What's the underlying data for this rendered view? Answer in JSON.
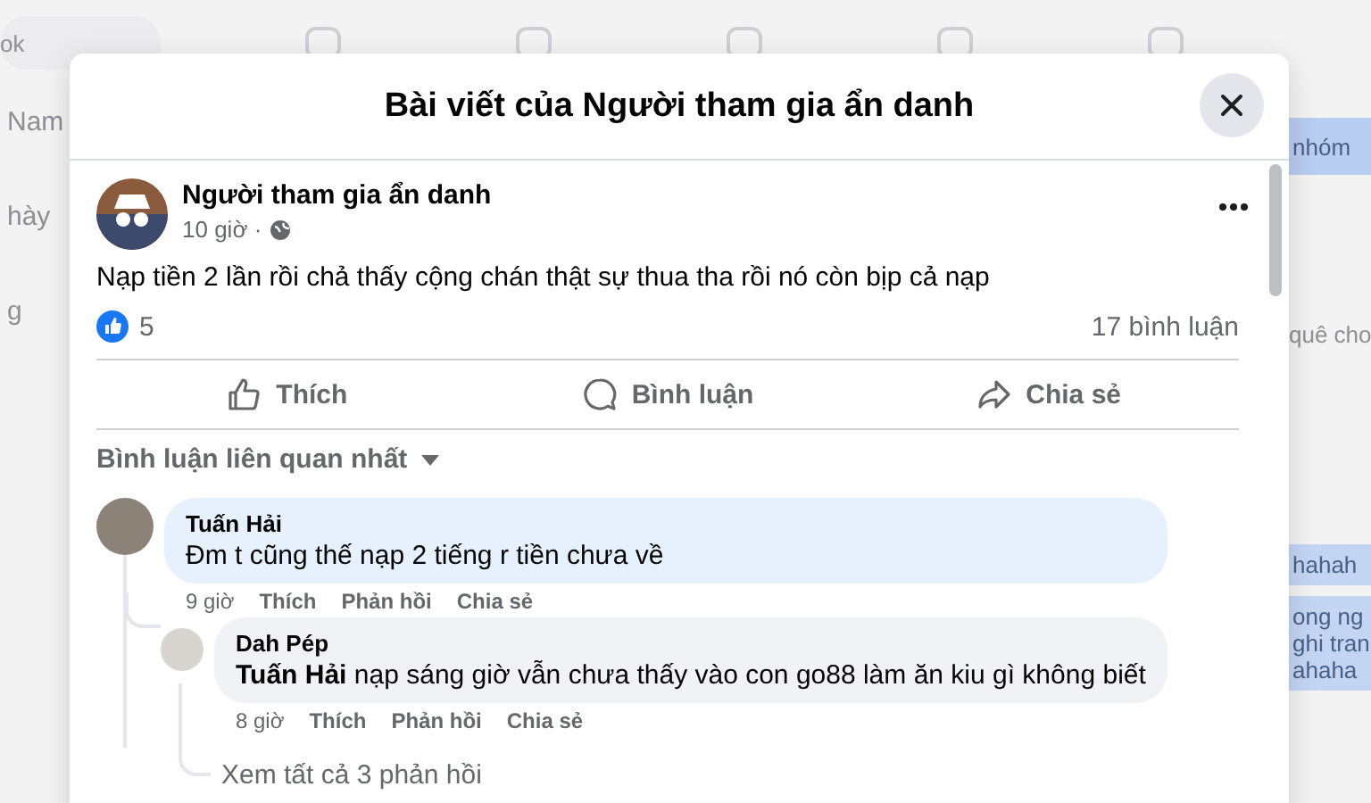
{
  "background": {
    "search_placeholder": "ok",
    "left_items": [
      "Nam",
      "hày",
      "g"
    ],
    "right_items": [
      {
        "kind": "button",
        "lines": [
          "nhóm"
        ]
      },
      {
        "kind": "text",
        "lines": [
          "quê cho"
        ]
      },
      {
        "kind": "bubble",
        "lines": [
          "hahah"
        ]
      },
      {
        "kind": "bubble",
        "lines": [
          "ong ng",
          "ghi tran",
          "ahaha"
        ]
      }
    ]
  },
  "dialog": {
    "title": "Bài viết của Người tham gia ẩn danh"
  },
  "post": {
    "author": "Người tham gia ẩn danh",
    "time": "10 giờ ·",
    "text": "Nạp tiền 2 lần rồi chả thấy cộng chán thật sự thua tha rồi nó còn bịp cả nạp",
    "reaction_count": "5",
    "comment_count": "17 bình luận",
    "actions": [
      {
        "kind": "like",
        "label": "Thích"
      },
      {
        "kind": "comment",
        "label": "Bình luận"
      },
      {
        "kind": "share",
        "label": "Chia sẻ"
      }
    ]
  },
  "sort": {
    "label": "Bình luận liên quan nhất"
  },
  "comments": [
    {
      "author": "Tuấn Hải",
      "text": "Đm t cũng thế nạp 2 tiếng r tiền chưa về",
      "time": "9 giờ",
      "actions": [
        "Thích",
        "Phản hồi",
        "Chia sẻ"
      ],
      "replies": [
        {
          "author": "Dah Pép",
          "text": "**Tuấn Hải** nạp sáng giờ vẫn chưa thấy vào con go88 làm ăn kiu gì không biết",
          "time": "8 giờ",
          "actions": [
            "Thích",
            "Phản hồi",
            "Chia sẻ"
          ]
        }
      ],
      "more_replies": "Xem tất cả 3 phản hồi"
    }
  ]
}
